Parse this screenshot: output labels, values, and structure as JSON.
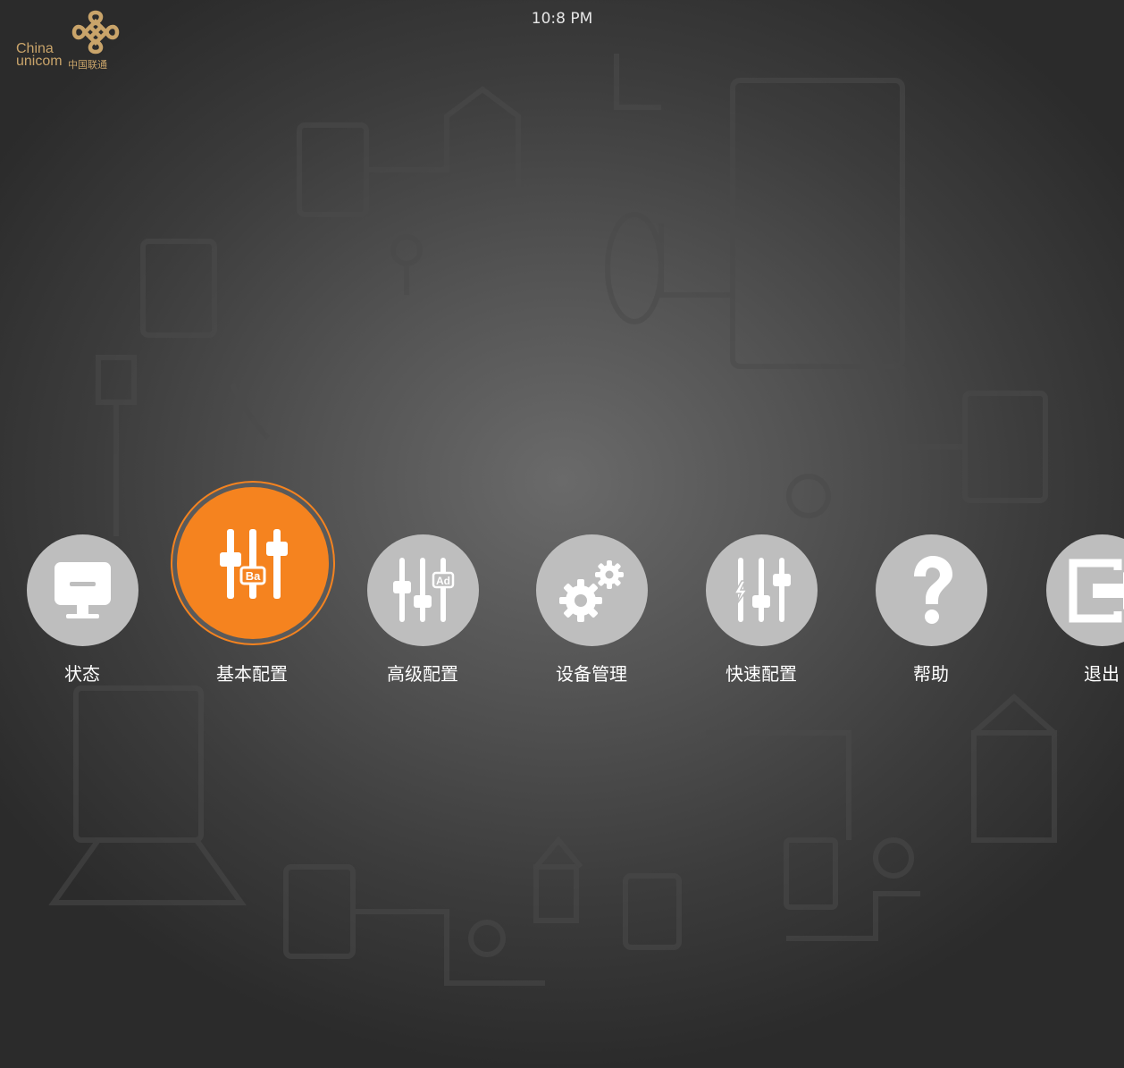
{
  "brand": {
    "name_en_line1": "China",
    "name_en_line2": "unicom",
    "name_cn": "中国联通",
    "color": "#c9a46a"
  },
  "clock": "10:8 PM",
  "colors": {
    "accent": "#f5831f",
    "icon_bg": "#bebebe",
    "label": "#ffffff"
  },
  "menu": {
    "items": [
      {
        "label": "状态",
        "icon": "monitor-icon",
        "active": false
      },
      {
        "label": "基本配置",
        "icon": "basic-settings-sliders-icon",
        "active": true
      },
      {
        "label": "高级配置",
        "icon": "advanced-settings-sliders-icon",
        "active": false
      },
      {
        "label": "设备管理",
        "icon": "gears-icon",
        "active": false
      },
      {
        "label": "快速配置",
        "icon": "quick-settings-sliders-icon",
        "active": false
      },
      {
        "label": "帮助",
        "icon": "question-mark-icon",
        "active": false
      },
      {
        "label": "退出",
        "icon": "exit-icon",
        "active": false
      }
    ]
  }
}
